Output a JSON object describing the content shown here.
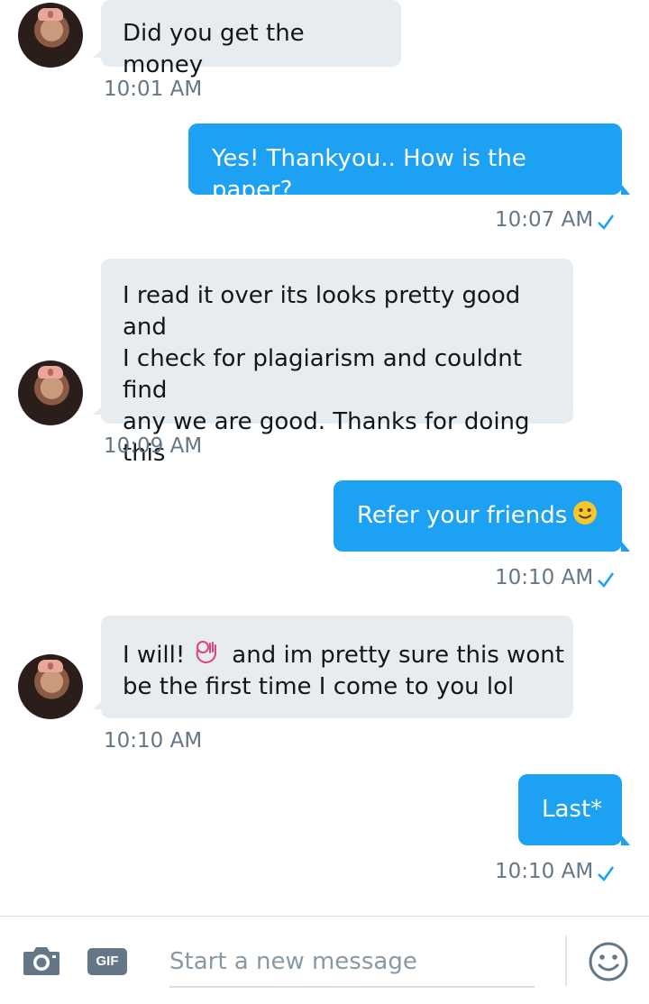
{
  "messages": [
    {
      "direction": "in",
      "text": "Did you get the money",
      "time": "10:01 AM"
    },
    {
      "direction": "out",
      "text": "Yes! Thankyou.. How is the paper?",
      "time": "10:07 AM"
    },
    {
      "direction": "in",
      "lines": [
        "I read it over its looks pretty good and",
        "I check for plagiarism and couldnt find",
        "any we are good. Thanks for doing",
        "this"
      ],
      "time": "10:09 AM"
    },
    {
      "direction": "out",
      "text": "Refer your friends",
      "emoji": "slightly-smiling-face",
      "time": "10:10 AM"
    },
    {
      "direction": "in",
      "line1_a": "I will!",
      "emoji": "ok-hand",
      "line1_b": "and im pretty sure this wont",
      "line2": "be the first time I come to you lol",
      "time": "10:10 AM"
    },
    {
      "direction": "out",
      "text": "Last*",
      "time": "10:10 AM"
    }
  ],
  "composer": {
    "camera_icon": "camera-icon",
    "gif_label": "GIF",
    "placeholder": "Start a new message",
    "emoji_icon": "smiley-icon"
  },
  "colors": {
    "outgoing": "#1da1f2",
    "incoming": "#e6ecf0",
    "timestamp": "#657786",
    "check": "#1da1f2"
  }
}
